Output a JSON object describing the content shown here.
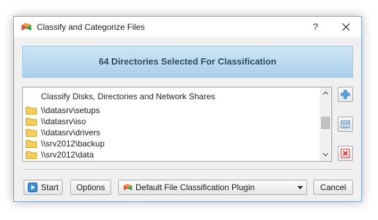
{
  "window": {
    "title": "Classify and Categorize Files",
    "help_label": "?"
  },
  "banner": {
    "text": "64 Directories Selected For Classification"
  },
  "list": {
    "header": "Classify Disks, Directories and Network Shares",
    "items": [
      {
        "label": "\\\\datasrv\\setups"
      },
      {
        "label": "\\\\datasrv\\iso"
      },
      {
        "label": "\\\\datasrv\\drivers"
      },
      {
        "label": "\\\\srv2012\\backup"
      },
      {
        "label": "\\\\srv2012\\data"
      }
    ]
  },
  "side_buttons": [
    {
      "icon": "add-icon"
    },
    {
      "icon": "edit-icon"
    },
    {
      "icon": "remove-icon"
    }
  ],
  "footer": {
    "start_label": "Start",
    "options_label": "Options",
    "plugin_selected": "Default File Classification Plugin",
    "cancel_label": "Cancel"
  },
  "colors": {
    "banner_text": "#2b4a63",
    "banner_bg": "#bcdcf0",
    "window_bg": "#f0f0f0",
    "folder": "#f2c94c"
  }
}
